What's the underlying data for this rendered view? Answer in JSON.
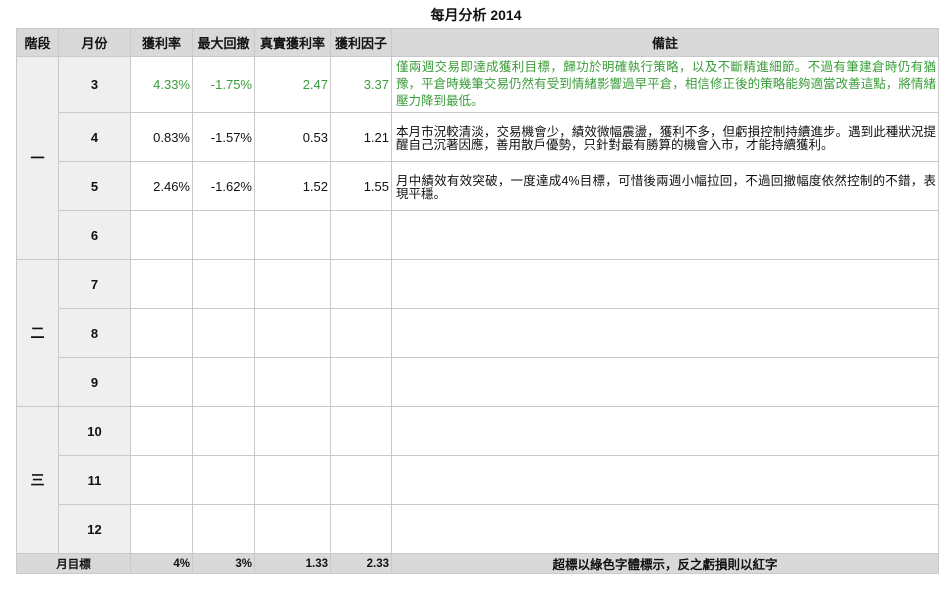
{
  "title": "每月分析 2014",
  "headers": {
    "stage": "階段",
    "month": "月份",
    "win_rate": "獲利率",
    "max_drawdown": "最大回撤",
    "real_win_rate": "真實獲利率",
    "profit_factor": "獲利因子",
    "notes": "備註"
  },
  "stages": [
    "一",
    "二",
    "三"
  ],
  "rows": [
    {
      "month": "3",
      "win_rate": "4.33%",
      "max_drawdown": "-1.75%",
      "real_win_rate": "2.47",
      "profit_factor": "3.37",
      "note": "僅兩週交易即達成獲利目標，歸功於明確執行策略，以及不斷精進細節。不過有筆建倉時仍有猶豫，平倉時幾筆交易仍然有受到情緒影響過早平倉，相信修正後的策略能夠適當改善這點，將情緒壓力降到最低。"
    },
    {
      "month": "4",
      "win_rate": "0.83%",
      "max_drawdown": "-1.57%",
      "real_win_rate": "0.53",
      "profit_factor": "1.21",
      "note": "本月市況較清淡，交易機會少，績效微幅震盪，獲利不多，但虧損控制持續進步。遇到此種狀況提醒自己沉著因應，善用散戶優勢，只針對最有勝算的機會入市，才能持續獲利。"
    },
    {
      "month": "5",
      "win_rate": "2.46%",
      "max_drawdown": "-1.62%",
      "real_win_rate": "1.52",
      "profit_factor": "1.55",
      "note": "月中績效有效突破，一度達成4%目標，可惜後兩週小幅拉回，不過回撤幅度依然控制的不錯，表現平穩。"
    },
    {
      "month": "6"
    },
    {
      "month": "7"
    },
    {
      "month": "8"
    },
    {
      "month": "9"
    },
    {
      "month": "10"
    },
    {
      "month": "11"
    },
    {
      "month": "12"
    }
  ],
  "target": {
    "label": "月目標",
    "win_rate": "4%",
    "max_drawdown": "3%",
    "real_win_rate": "1.33",
    "profit_factor": "2.33",
    "note": "超標以綠色字體標示，反之虧損則以紅字"
  },
  "colors": {
    "above_target": "#3a9d3a",
    "header_bg": "#d9d9d9",
    "side_bg": "#efefef"
  }
}
